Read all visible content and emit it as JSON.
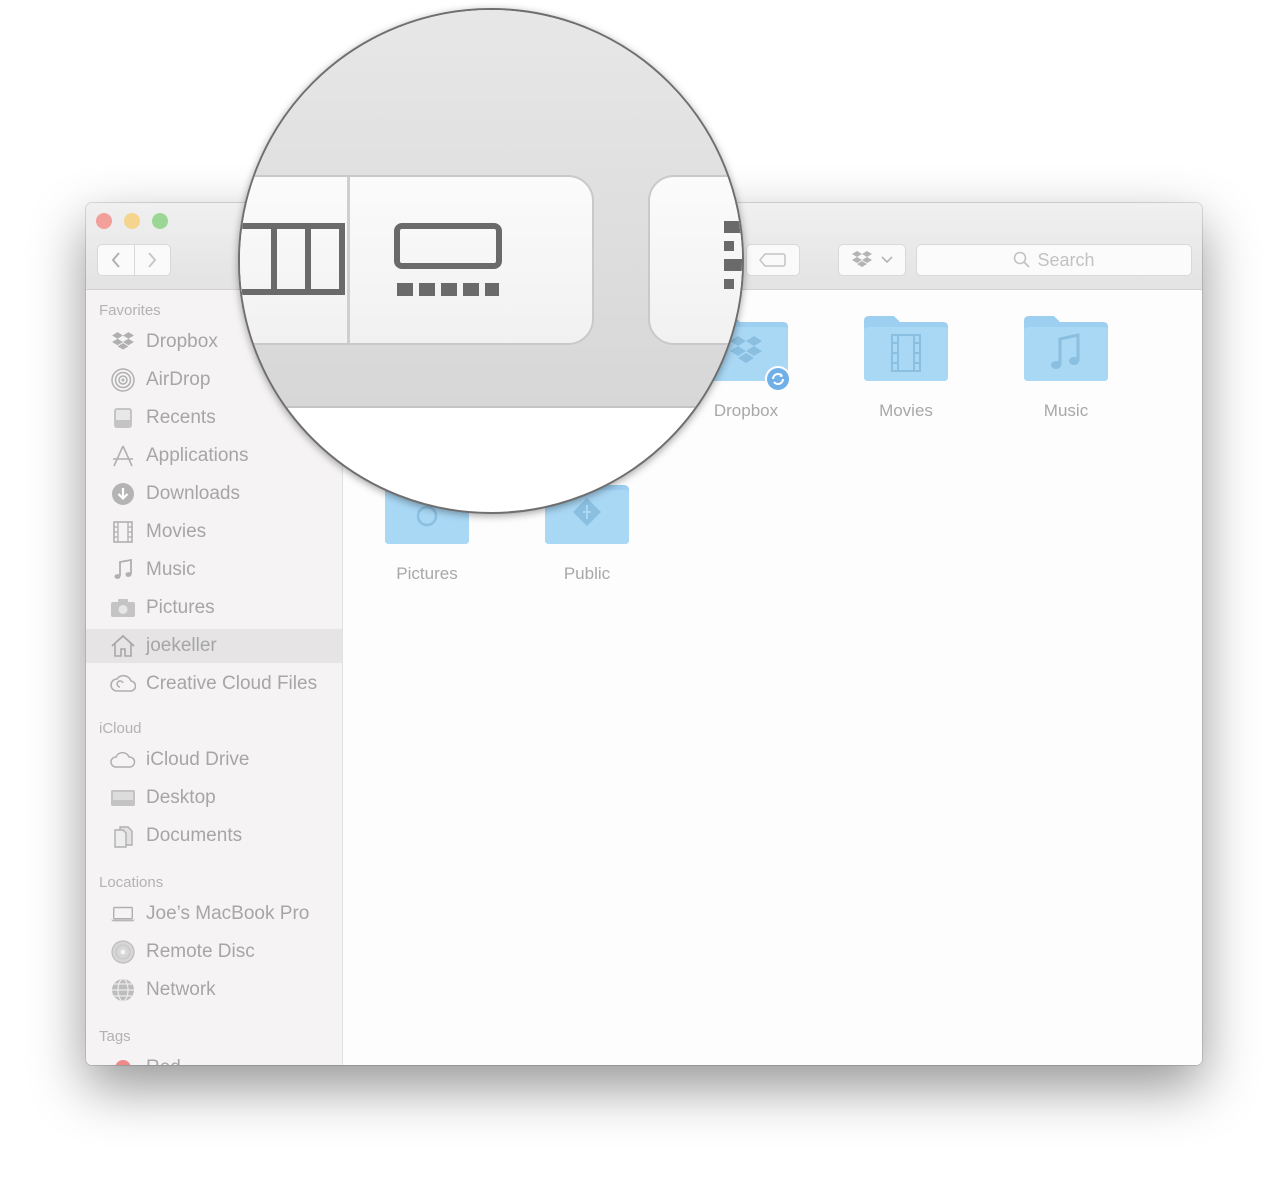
{
  "window": {
    "search_placeholder": "Search"
  },
  "sidebar": {
    "sections": {
      "favorites": "Favorites",
      "icloud": "iCloud",
      "locations": "Locations",
      "tags": "Tags"
    },
    "favorites": [
      {
        "label": "Dropbox",
        "icon": "dropbox-icon"
      },
      {
        "label": "AirDrop",
        "icon": "airdrop-icon"
      },
      {
        "label": "Recents",
        "icon": "recents-icon"
      },
      {
        "label": "Applications",
        "icon": "applications-icon"
      },
      {
        "label": "Downloads",
        "icon": "downloads-icon"
      },
      {
        "label": "Movies",
        "icon": "movies-icon"
      },
      {
        "label": "Music",
        "icon": "music-icon"
      },
      {
        "label": "Pictures",
        "icon": "pictures-icon"
      },
      {
        "label": "joekeller",
        "icon": "home-icon",
        "selected": true
      },
      {
        "label": "Creative Cloud Files",
        "icon": "creative-cloud-icon"
      }
    ],
    "icloud": [
      {
        "label": "iCloud Drive",
        "icon": "cloud-icon"
      },
      {
        "label": "Desktop",
        "icon": "desktop-icon"
      },
      {
        "label": "Documents",
        "icon": "documents-icon"
      }
    ],
    "locations": [
      {
        "label": "Joe’s MacBook Pro",
        "icon": "laptop-icon"
      },
      {
        "label": "Remote Disc",
        "icon": "disc-icon"
      },
      {
        "label": "Network",
        "icon": "network-icon"
      }
    ],
    "tags": [
      {
        "label": "Red",
        "color": "#f08a8a"
      }
    ]
  },
  "content": {
    "items": [
      {
        "label": "Dropbox",
        "icon": "dropbox-folder-icon"
      },
      {
        "label": "Movies",
        "icon": "movies-folder-icon"
      },
      {
        "label": "Music",
        "icon": "music-folder-icon"
      },
      {
        "label": "Pictures",
        "icon": "pictures-folder-icon"
      },
      {
        "label": "Public",
        "icon": "public-folder-icon"
      }
    ]
  },
  "colors": {
    "folder": "#a9d8f5",
    "folder_tab": "#9ccff0",
    "folder_glyph": "#8bbfe0",
    "sync_badge": "#6fb0e8"
  }
}
